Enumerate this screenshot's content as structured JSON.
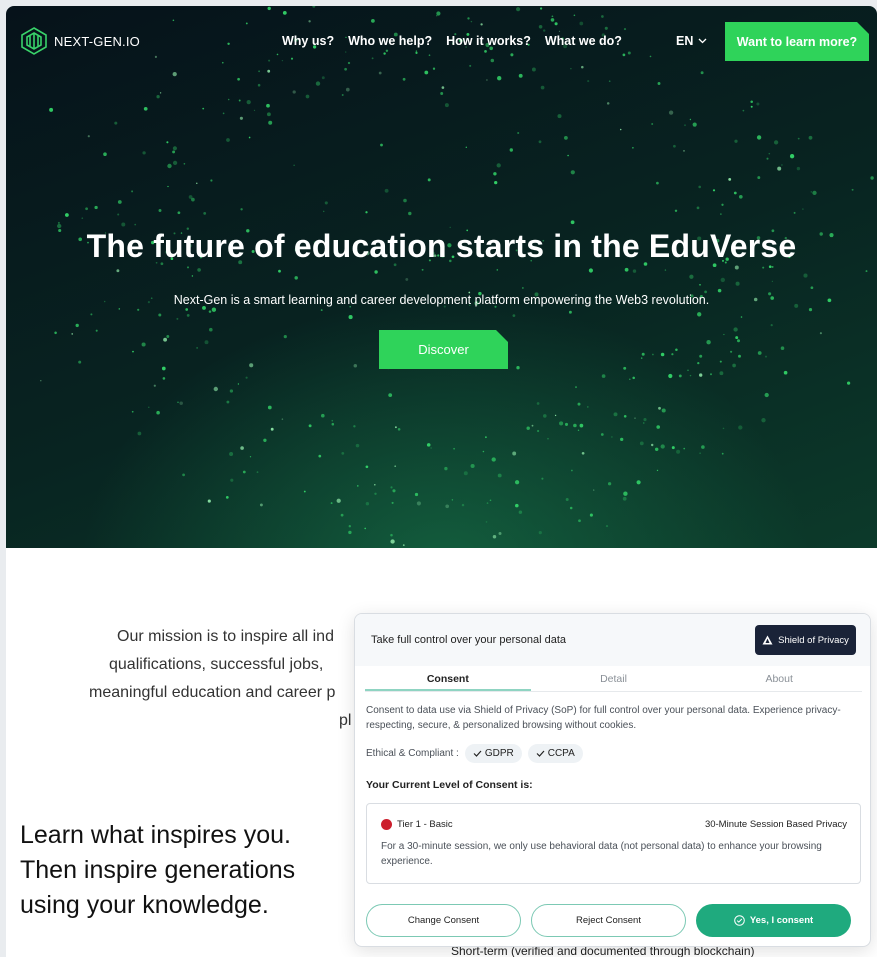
{
  "nav": {
    "logo_text": "NEXT-GEN.IO",
    "links": [
      "Why us?",
      "Who we help?",
      "How it works?",
      "What we do?"
    ],
    "language": "EN",
    "cta_label": "Want to learn more?"
  },
  "hero": {
    "title": "The future of education starts in the EduVerse",
    "subtitle": "Next-Gen is a smart learning and career development platform empowering the Web3 revolution.",
    "button_label": "Discover"
  },
  "mission": {
    "lines": [
      "Our mission is to inspire all ind",
      "qualifications, successful jobs, ",
      "meaningful education and career p",
      "pl"
    ]
  },
  "inspire": {
    "text": "Learn what inspires you. Then inspire generations using your knowledge."
  },
  "shortterm_text": "Short-term (verified and documented through blockchain)",
  "consent": {
    "header_title": "Take full control over your personal data",
    "badge_label": "Shield of Privacy",
    "tabs": [
      "Consent",
      "Detail",
      "About"
    ],
    "active_tab": "Consent",
    "description": "Consent to data use via Shield of Privacy (SoP) for full control over your personal data. Experience privacy-respecting, secure, & personalized browsing without cookies.",
    "compliance_label": "Ethical & Compliant :",
    "chips": [
      "GDPR",
      "CCPA"
    ],
    "level_title": "Your Current Level of Consent is:",
    "tier": {
      "name": "Tier 1 - Basic",
      "right_label": "30-Minute Session Based Privacy",
      "description": "For a 30-minute session, we only use behavioral data (not personal data) to enhance your browsing experience.",
      "dot_color": "#cc1f2d"
    },
    "buttons": {
      "change": "Change Consent",
      "reject": "Reject Consent",
      "accept": "Yes, I consent"
    }
  },
  "colors": {
    "accent_green": "#2fd35a",
    "consent_green": "#1faa7e"
  }
}
